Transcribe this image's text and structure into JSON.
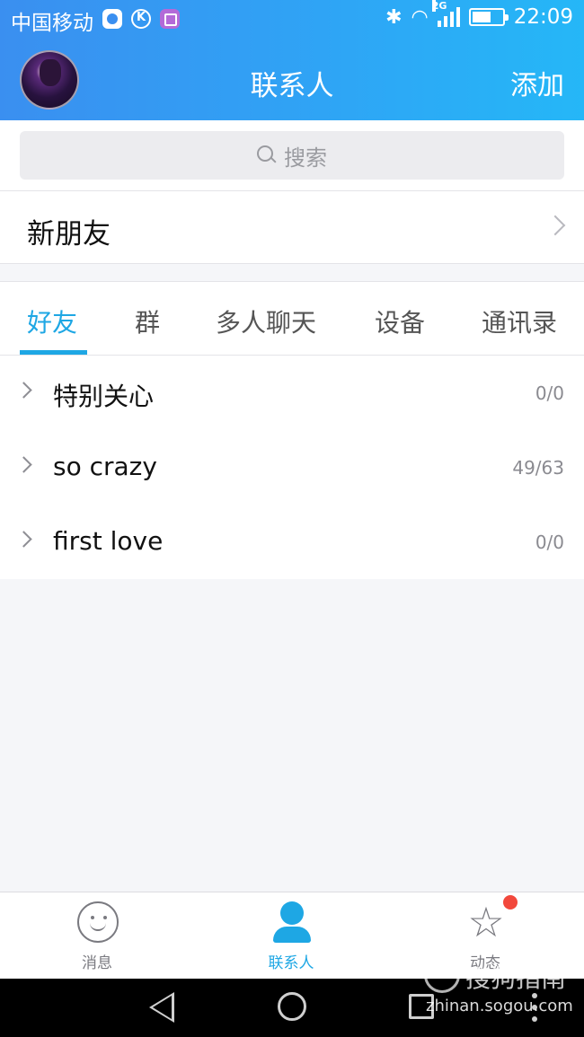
{
  "status_bar": {
    "carrier": "中国移动",
    "network": "2G",
    "time": "22:09"
  },
  "header": {
    "title": "联系人",
    "add_label": "添加"
  },
  "search": {
    "placeholder": "搜索"
  },
  "new_friends": {
    "label": "新朋友"
  },
  "tabs": [
    {
      "label": "好友",
      "active": true
    },
    {
      "label": "群",
      "active": false
    },
    {
      "label": "多人聊天",
      "active": false
    },
    {
      "label": "设备",
      "active": false
    },
    {
      "label": "通讯录",
      "active": false
    }
  ],
  "groups": [
    {
      "name": "特别关心",
      "count": "0/0"
    },
    {
      "name": "so crazy",
      "count": "49/63"
    },
    {
      "name": "first love",
      "count": "0/0"
    }
  ],
  "bottom_nav": [
    {
      "label": "消息",
      "icon": "message-smile-icon",
      "active": false
    },
    {
      "label": "联系人",
      "icon": "contact-person-icon",
      "active": true
    },
    {
      "label": "动态",
      "icon": "star-icon",
      "active": false,
      "badge": true
    }
  ],
  "watermark": {
    "title": "搜狗指南",
    "url": "zhinan.sogou.com"
  },
  "colors": {
    "accent": "#1ea7e4",
    "header_start": "#3a8ff0",
    "header_end": "#25b7f7",
    "badge": "#f2483c"
  }
}
